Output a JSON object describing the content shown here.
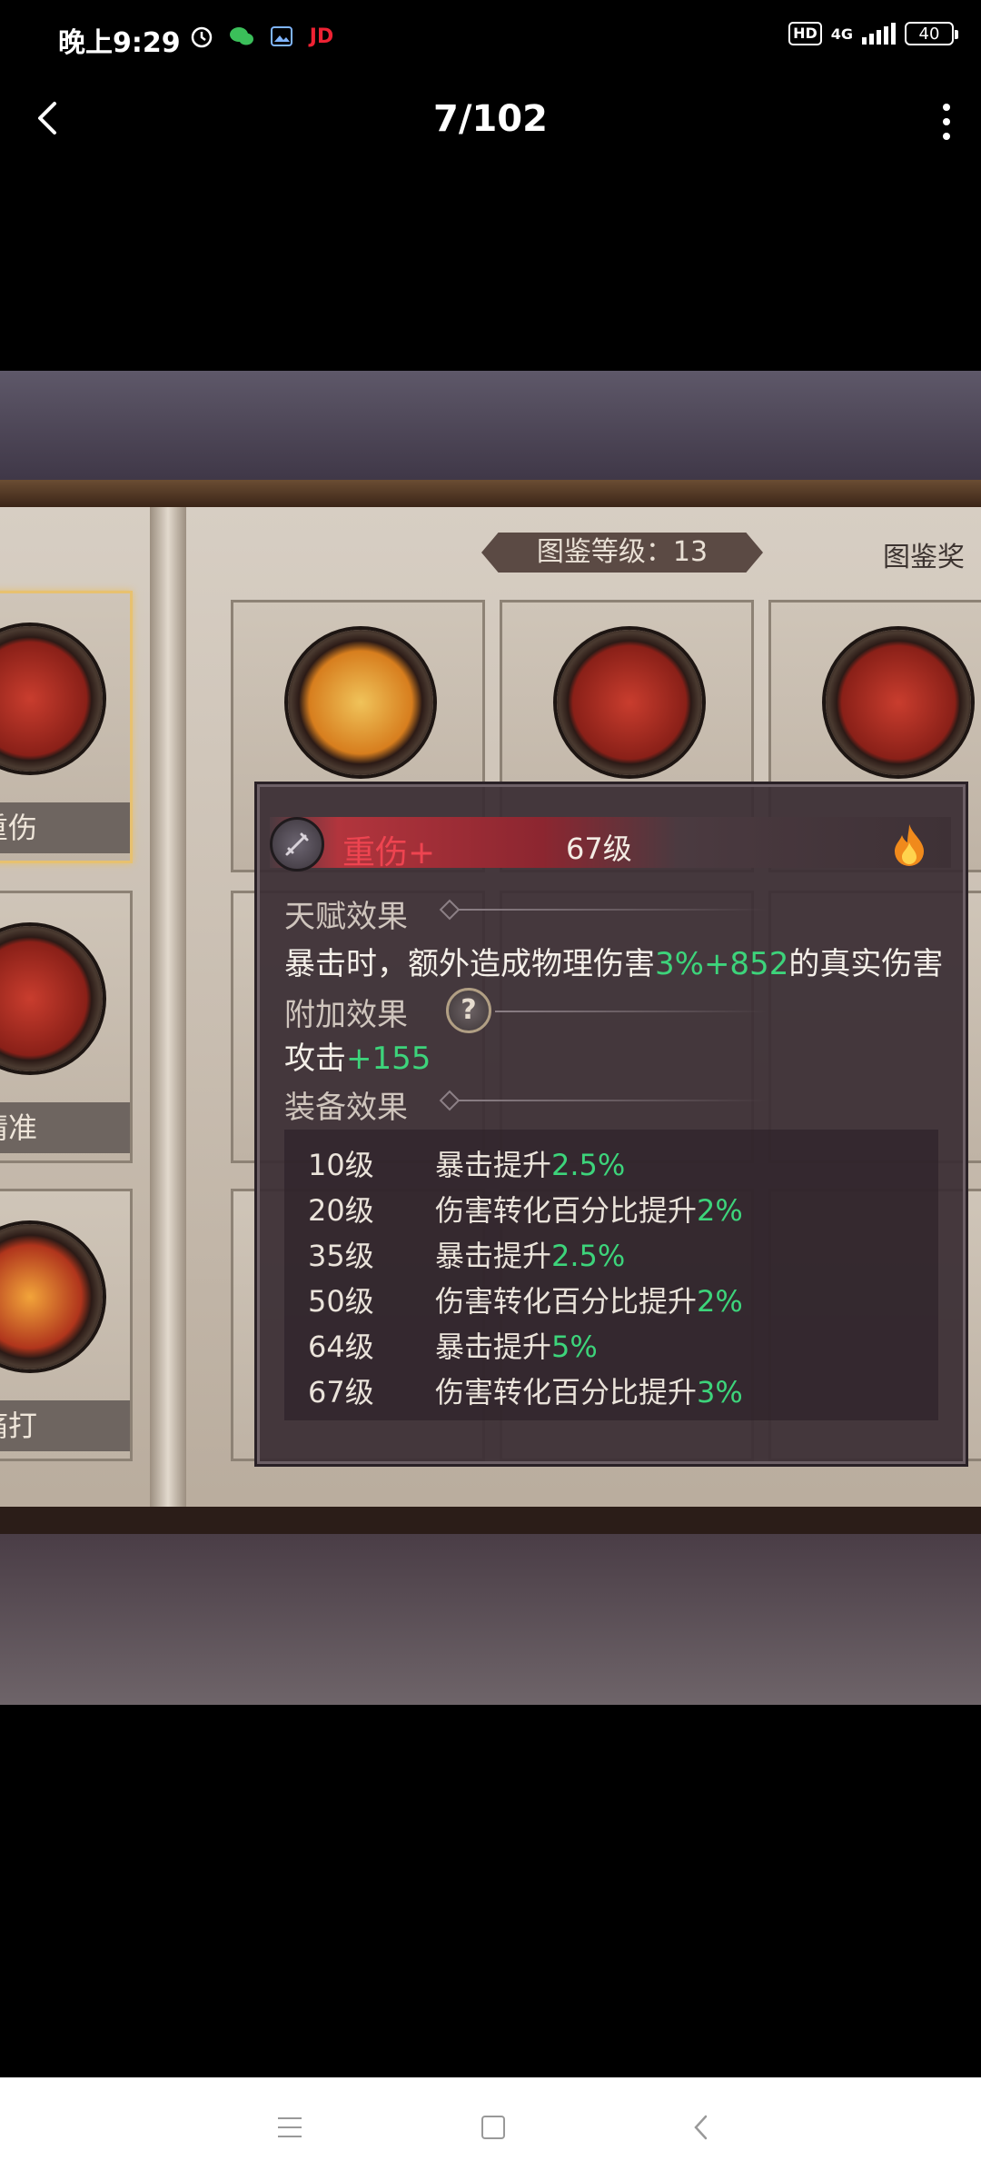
{
  "status_bar": {
    "time": "晚上9:29",
    "left_icons": [
      "alarm-icon",
      "wechat-icon",
      "gallery-icon",
      "jd-icon"
    ],
    "jd_text": "JD",
    "hd": "HD",
    "network": "4G",
    "battery": "40"
  },
  "title_bar": {
    "counter": "7/102"
  },
  "photo": {
    "level_banner": "图鉴等级：13",
    "reward_label": "图鉴奖",
    "cards": [
      {
        "label": "重伤"
      },
      {
        "label": "精准"
      },
      {
        "label": "痛打"
      }
    ]
  },
  "tooltip": {
    "name": "重伤+",
    "level": "67级",
    "talent_title": "天赋效果",
    "talent_text_a": "暴击时，额外造成物理伤害",
    "talent_value": "3%+852",
    "talent_text_b": "的真实伤害",
    "extra_title": "附加效果",
    "extra_text": "攻击",
    "extra_value": "+155",
    "equip_title": "装备效果",
    "equip_rows": [
      {
        "level": "10级",
        "desc": "暴击提升",
        "value": "2.5%"
      },
      {
        "level": "20级",
        "desc": "伤害转化百分比提升",
        "value": "2%"
      },
      {
        "level": "35级",
        "desc": "暴击提升",
        "value": "2.5%"
      },
      {
        "level": "50级",
        "desc": "伤害转化百分比提升",
        "value": "2%"
      },
      {
        "level": "64级",
        "desc": "暴击提升",
        "value": "5%"
      },
      {
        "level": "67级",
        "desc": "伤害转化百分比提升",
        "value": "3%"
      }
    ]
  },
  "colors": {
    "value_green": "#3dd47b",
    "name_red": "#ee4450"
  }
}
